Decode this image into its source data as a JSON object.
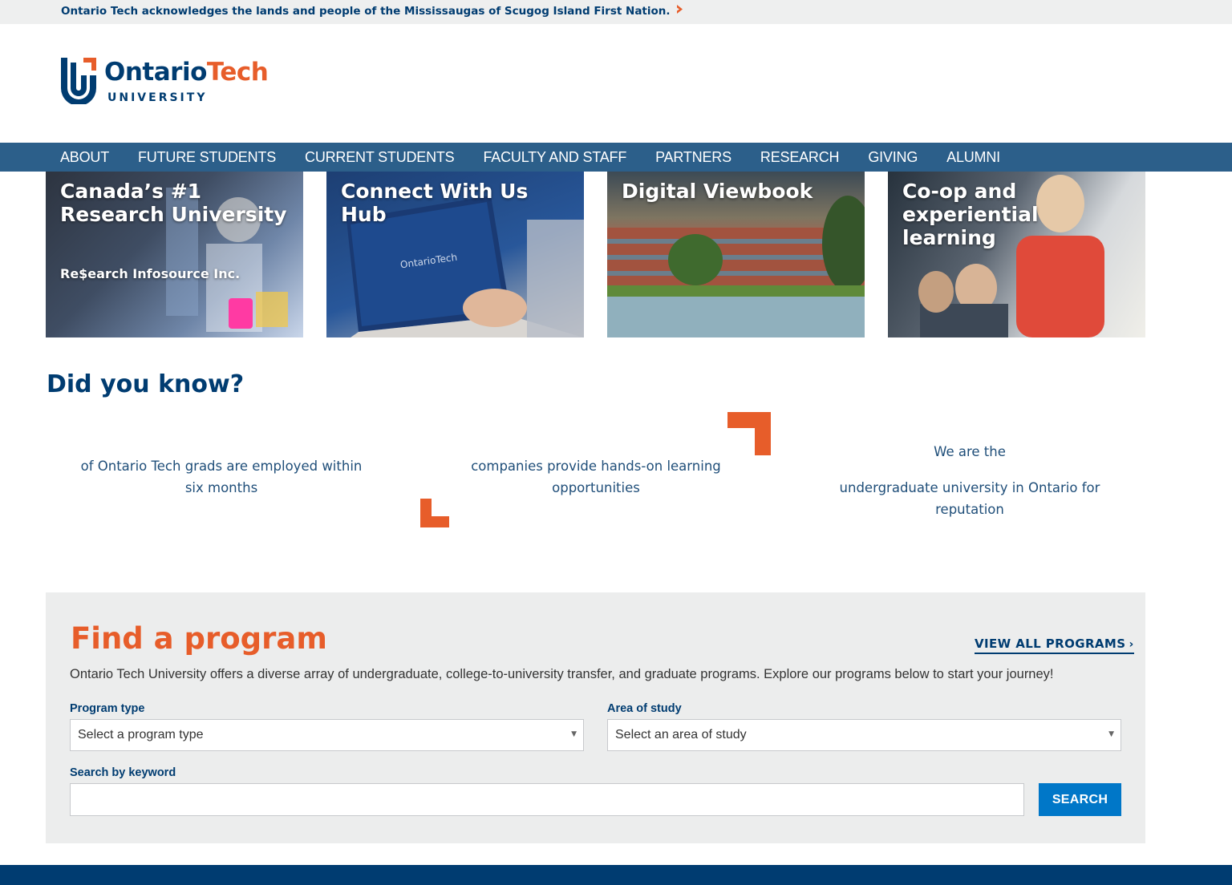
{
  "acknowledgement": {
    "text": "Ontario Tech acknowledges the lands and people of the Mississaugas of Scugog Island First Nation.",
    "arrow_icon": "chevron-right-icon"
  },
  "logo": {
    "word_part1": "Ontario",
    "word_part2": "Tech",
    "sub": "UNIVERSITY"
  },
  "nav": {
    "items": [
      "ABOUT",
      "FUTURE STUDENTS",
      "CURRENT STUDENTS",
      "FACULTY AND STAFF",
      "PARTNERS",
      "RESEARCH",
      "GIVING",
      "ALUMNI"
    ]
  },
  "tiles": [
    {
      "title": "Canada’s #1 Research University",
      "subtitle": "Re$earch Infosource Inc."
    },
    {
      "title": "Connect With Us Hub",
      "subtitle": ""
    },
    {
      "title": "Digital Viewbook",
      "subtitle": ""
    },
    {
      "title": "Co-op and experiential learning",
      "subtitle": ""
    }
  ],
  "did_you_know": {
    "heading": "Did you know?",
    "facts": [
      {
        "pre": "",
        "text": "of Ontario Tech grads are employed within six months"
      },
      {
        "pre": "",
        "text": "companies provide hands-on learning opportunities"
      },
      {
        "pre": "We are the",
        "text": "undergraduate university in Ontario for reputation"
      }
    ]
  },
  "find_program": {
    "title": "Find a program",
    "view_all": "VIEW ALL PROGRAMS",
    "description": "Ontario Tech University offers a diverse array of undergraduate, college-to-university transfer, and graduate programs. Explore our programs below to start your journey!",
    "program_type_label": "Program type",
    "program_type_value": "Select a program type",
    "area_label": "Area of study",
    "area_value": "Select an area of study",
    "keyword_label": "Search by keyword",
    "keyword_value": "",
    "search_button": "SEARCH"
  },
  "colors": {
    "navy": "#003c71",
    "nav_blue": "#2c5f8a",
    "orange": "#e75d2a",
    "search_blue": "#0077c8",
    "panel_gray": "#eceded"
  }
}
